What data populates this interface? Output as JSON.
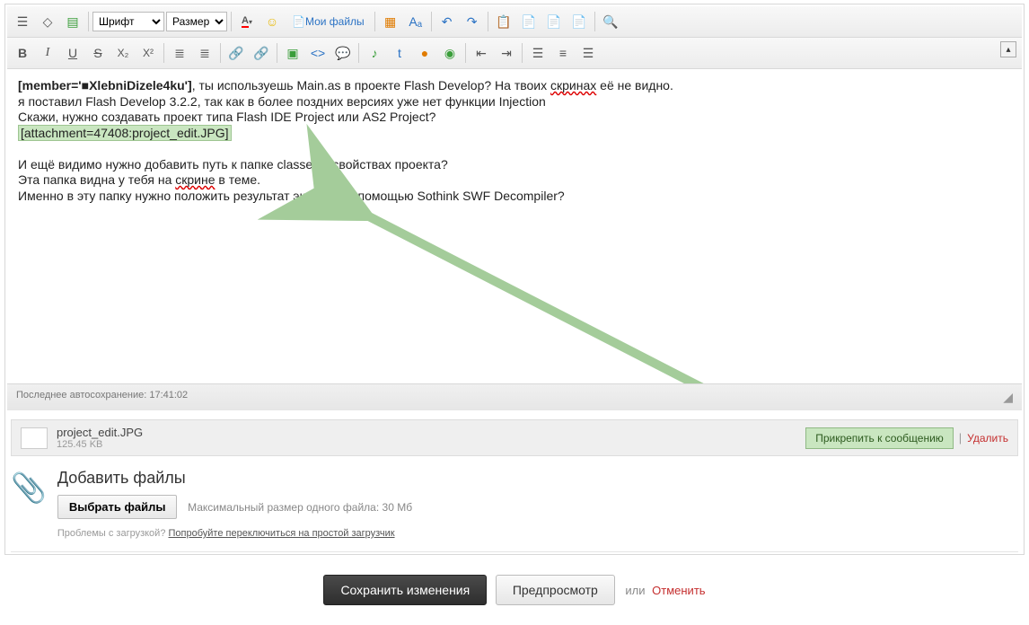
{
  "toolbar": {
    "font_placeholder": "Шрифт",
    "size_placeholder": "Размер",
    "myfiles_label": " Мои файлы"
  },
  "editor": {
    "member_tag": "[member='■XlebniDizele4ku']",
    "line1_a": ", ты используешь Main.as в проекте Flash Develop? На твоих ",
    "line1_wavy": "скринах",
    "line1_b": " её не видно.",
    "line2": "я поставил Flash Develop 3.2.2, так как в более поздних версиях уже нет функции Injection",
    "line3": "Скажи, нужно создавать проект типа Flash IDE Project или AS2 Project?",
    "attach_tag": "[attachment=47408:project_edit.JPG]",
    "line5": "И ещё видимо нужно добавить путь к папке classes в свойствах проекта?",
    "line6_a": "Эта папка видна у тебя на ",
    "line6_wavy": "скрине",
    "line6_b": " в теме.",
    "line7": "Именно в эту папку нужно положить результат экспорта с помощью Sothink SWF Decompiler?"
  },
  "status": {
    "autosave": "Последнее автосохранение: 17:41:02"
  },
  "attachment": {
    "name": "project_edit.JPG",
    "size": "125.45 KB",
    "attach_label": "Прикрепить к сообщению",
    "delete_label": "Удалить"
  },
  "upload": {
    "title": "Добавить файлы",
    "button": "Выбрать файлы",
    "hint": "Максимальный размер одного файла: 30 Мб",
    "problems": "Проблемы с загрузкой? ",
    "problems_link": "Попробуйте переключиться на простой загрузчик"
  },
  "footer": {
    "save": "Сохранить изменения",
    "preview": "Предпросмотр",
    "or": "или",
    "cancel": "Отменить"
  }
}
